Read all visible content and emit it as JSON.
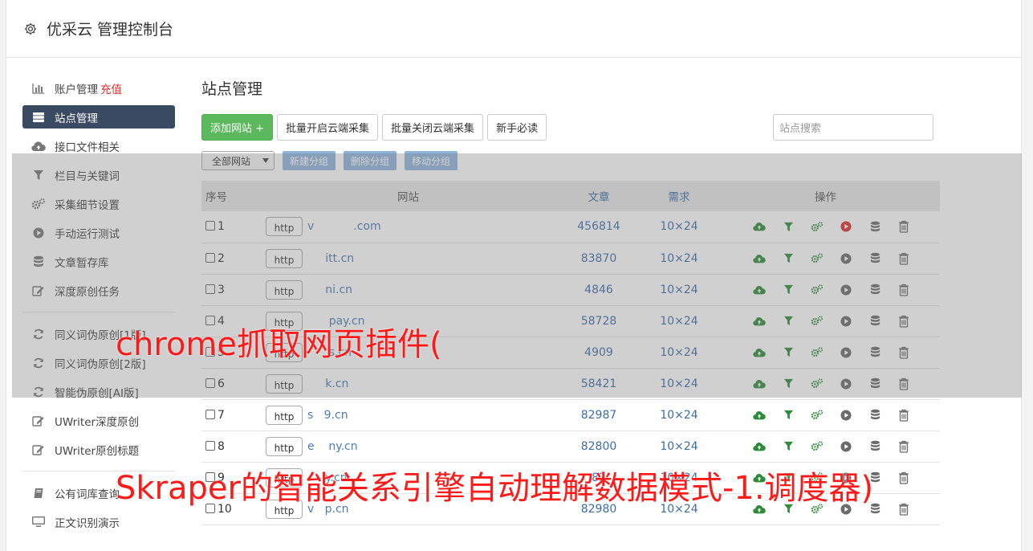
{
  "app": {
    "title": "优采云 管理控制台"
  },
  "sidebar": {
    "items": [
      {
        "label": "账户管理",
        "extra": "充值",
        "icon": "bar-chart-icon"
      },
      {
        "label": "站点管理",
        "icon": "server-icon",
        "active": true
      },
      {
        "label": "接口文件相关",
        "icon": "cloud-upload-icon"
      },
      {
        "label": "栏目与关键词",
        "icon": "filter-icon"
      },
      {
        "label": "采集细节设置",
        "icon": "gears-icon"
      },
      {
        "label": "手动运行测试",
        "icon": "play-circle-icon"
      },
      {
        "label": "文章暂存库",
        "icon": "database-icon"
      },
      {
        "label": "深度原创任务",
        "icon": "edit-icon"
      },
      {
        "label": "同义词伪原创[1版]",
        "icon": "refresh-icon"
      },
      {
        "label": "同义词伪原创[2版]",
        "icon": "refresh-icon"
      },
      {
        "label": "智能伪原创[AI版]",
        "icon": "refresh-icon"
      },
      {
        "label": "UWriter深度原创",
        "icon": "edit-icon"
      },
      {
        "label": "UWriter原创标题",
        "icon": "edit-icon"
      },
      {
        "label": "公有词库查询",
        "icon": "book-icon"
      },
      {
        "label": "正文识别演示",
        "icon": "monitor-icon"
      }
    ]
  },
  "main": {
    "title": "站点管理",
    "buttons": {
      "add_site": "添加网站 +",
      "batch_enable": "批量开启云端采集",
      "batch_disable": "批量关闭云端采集",
      "newbie": "新手必读"
    },
    "search_placeholder": "站点搜索",
    "group_select": "全部网站",
    "group_buttons": {
      "new": "新建分组",
      "delete": "删除分组",
      "move": "移动分组"
    },
    "table": {
      "headers": {
        "no": "序号",
        "site": "网站",
        "articles": "文章",
        "demand": "需求",
        "ops": "操作"
      },
      "rows": [
        {
          "no": "1",
          "http": "http",
          "domain": "v           .com",
          "articles": "456814",
          "demand": "10×24",
          "run_active": true
        },
        {
          "no": "2",
          "http": "http",
          "domain": "     itt.cn",
          "articles": "83870",
          "demand": "10×24"
        },
        {
          "no": "3",
          "http": "http",
          "domain": "     ni.cn",
          "articles": "4846",
          "demand": "10×24"
        },
        {
          "no": "4",
          "http": "http",
          "domain": "      pay.cn",
          "articles": "58728",
          "demand": "10×24"
        },
        {
          "no": "5",
          "http": "http",
          "domain": "      s.cn",
          "articles": "4909",
          "demand": "10×24"
        },
        {
          "no": "6",
          "http": "http",
          "domain": "     k.cn",
          "articles": "58421",
          "demand": "10×24"
        },
        {
          "no": "7",
          "http": "http",
          "domain": "s   9.cn",
          "articles": "82987",
          "demand": "10×24"
        },
        {
          "no": "8",
          "http": "http",
          "domain": "e    ny.cn",
          "articles": "82800",
          "demand": "10×24"
        },
        {
          "no": "9",
          "http": "http",
          "domain": "     y.cn",
          "articles": "82   ",
          "demand": "10×24"
        },
        {
          "no": "10",
          "http": "http",
          "domain": "v   p.cn",
          "articles": "82980",
          "demand": "10×24"
        }
      ]
    }
  },
  "captions": {
    "line1": "chrome抓取网页插件(",
    "line2": "Skraper的智能关系引擎自动理解数据模式-1.调度器)"
  },
  "colors": {
    "active_sidebar": "#3b4a63",
    "green": "#5cb85c",
    "caption": "#ff1a1a",
    "link": "#3a6da8"
  }
}
